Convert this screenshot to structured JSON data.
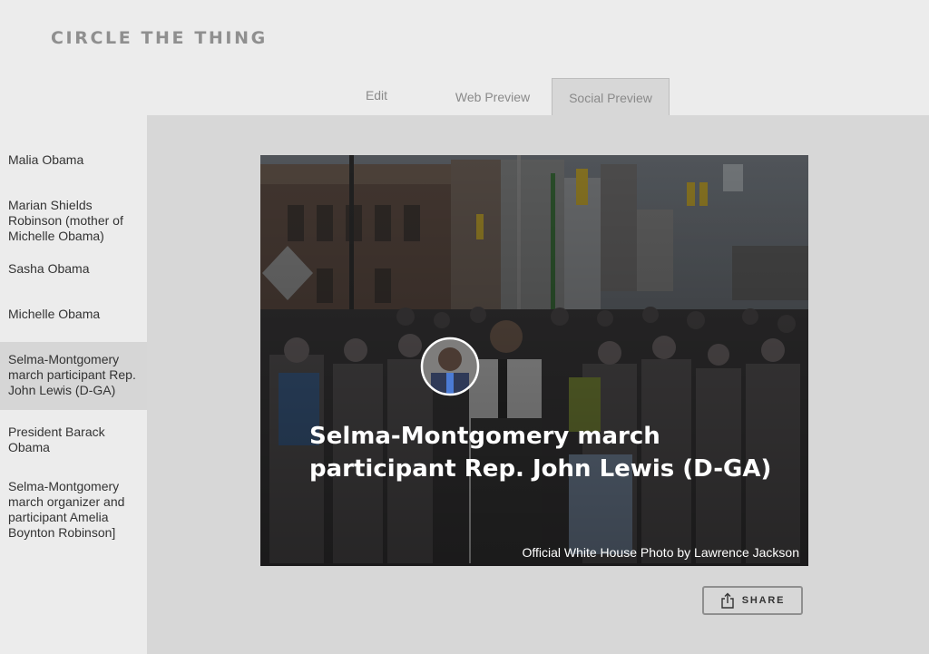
{
  "app": {
    "title": "CIRCLE THE THING"
  },
  "tabs": [
    {
      "label": "Edit",
      "active": false
    },
    {
      "label": "Web Preview",
      "active": false
    },
    {
      "label": "Social Preview",
      "active": true
    }
  ],
  "sidebar": {
    "items": [
      {
        "label": "Malia Obama",
        "active": false
      },
      {
        "label": "Marian Shields Robinson (mother of Michelle Obama)",
        "active": false
      },
      {
        "label": "Sasha Obama",
        "active": false
      },
      {
        "label": "Michelle Obama",
        "active": false
      },
      {
        "label": "Selma-Montgomery march participant Rep. John Lewis (D-GA)",
        "active": true
      },
      {
        "label": "President Barack Obama",
        "active": false
      },
      {
        "label": "Selma-Montgomery march organizer and participant Amelia Boynton Robinson]",
        "active": false
      }
    ]
  },
  "preview": {
    "title": "Selma-Montgomery march participant Rep. John Lewis (D-GA)",
    "credit": "Official White House Photo by Lawrence Jackson",
    "share_label": "SHARE",
    "share_icon": "share-icon"
  },
  "colors": {
    "background": "#ececec",
    "panel": "#d7d7d7",
    "active_item": "#d6d6d6",
    "title_gray": "#8f8f8f"
  }
}
